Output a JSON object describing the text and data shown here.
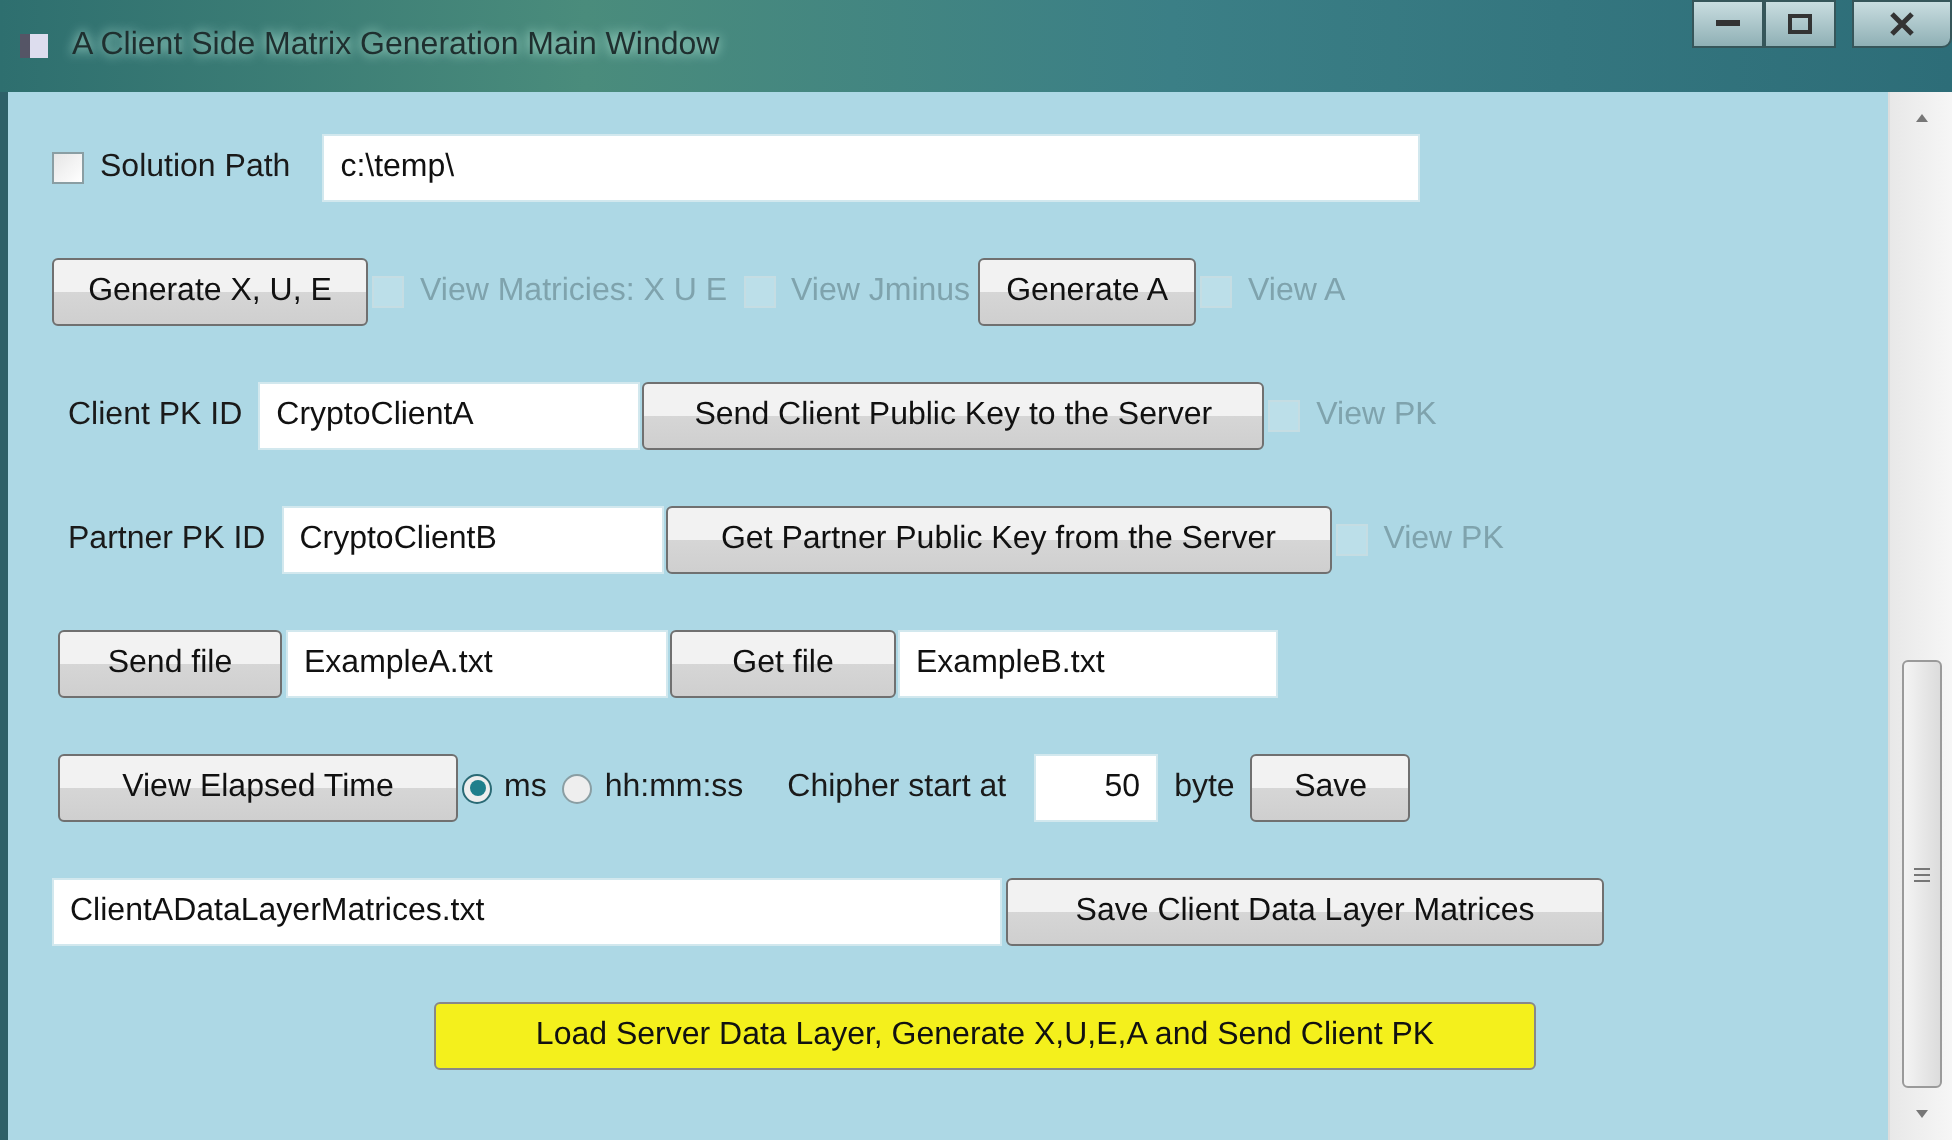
{
  "window": {
    "title": "A Client Side Matrix Generation Main Window"
  },
  "rows": [
    {
      "items": [
        {
          "kind": "checkbox",
          "label": "Solution Path",
          "checked": false,
          "disabled": false
        },
        {
          "kind": "field",
          "value": "c:\\temp\\"
        }
      ]
    },
    {
      "items": [
        {
          "kind": "button",
          "label": "Generate X, U, E"
        },
        {
          "kind": "checkbox",
          "label": "View Matricies: X U E",
          "checked": false,
          "disabled": true
        },
        {
          "kind": "checkbox",
          "label": "View Jminus",
          "checked": false,
          "disabled": true
        },
        {
          "kind": "button",
          "label": "Generate A"
        },
        {
          "kind": "checkbox",
          "label": "View A",
          "checked": false,
          "disabled": true
        }
      ]
    },
    {
      "items": [
        {
          "kind": "label",
          "label": "Client PK ID"
        },
        {
          "kind": "field",
          "value": "CryptoClientA"
        },
        {
          "kind": "button",
          "label": "Send Client Public Key to the Server"
        },
        {
          "kind": "checkbox",
          "label": "View PK",
          "checked": false,
          "disabled": true
        }
      ]
    },
    {
      "items": [
        {
          "kind": "label",
          "label": "Partner PK ID"
        },
        {
          "kind": "field",
          "value": "CryptoClientB"
        },
        {
          "kind": "button",
          "label": "Get Partner Public Key from the Server"
        },
        {
          "kind": "checkbox",
          "label": "View PK",
          "checked": false,
          "disabled": true
        }
      ]
    },
    {
      "items": [
        {
          "kind": "button",
          "label": "Send file"
        },
        {
          "kind": "field",
          "value": "ExampleA.txt"
        },
        {
          "kind": "button",
          "label": "Get file"
        },
        {
          "kind": "field",
          "value": "ExampleB.txt"
        }
      ]
    },
    {
      "items": [
        {
          "kind": "button",
          "label": "View Elapsed Time"
        },
        {
          "kind": "radio",
          "label": "ms",
          "selected": true
        },
        {
          "kind": "radio",
          "label": "hh:mm:ss",
          "selected": false
        },
        {
          "kind": "label",
          "label": "Chipher start at"
        },
        {
          "kind": "number",
          "value": "50"
        },
        {
          "kind": "label",
          "label": "byte"
        },
        {
          "kind": "button",
          "label": "Save"
        }
      ]
    },
    {
      "items": [
        {
          "kind": "field",
          "value": "ClientADataLayerMatrices.txt"
        },
        {
          "kind": "button",
          "label": "Save Client Data Layer Matrices"
        }
      ]
    },
    {
      "items": [
        {
          "kind": "button",
          "label": "Load Server Data Layer, Generate X,U,E,A and Send Client PK",
          "color": "#f4f01c"
        }
      ]
    }
  ]
}
